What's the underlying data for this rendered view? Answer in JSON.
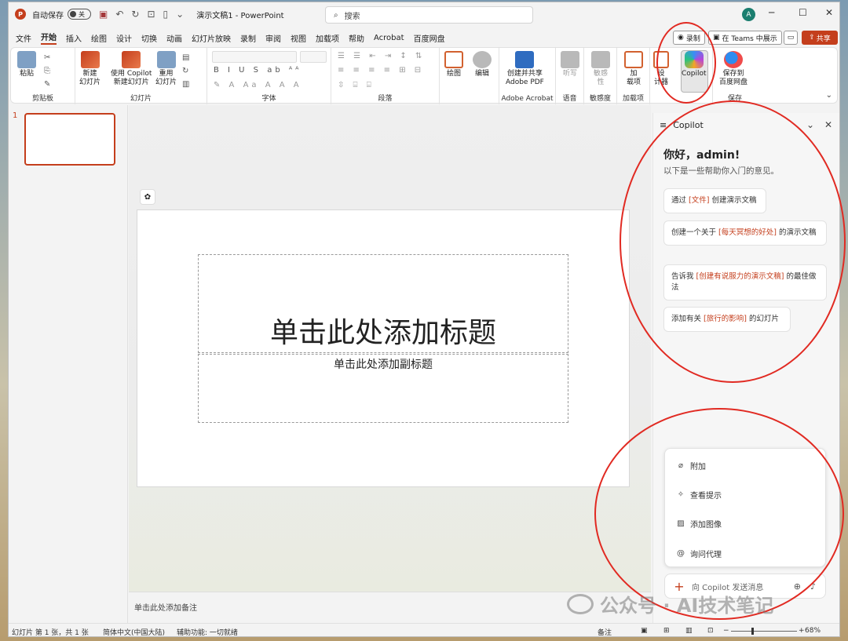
{
  "titlebar": {
    "autosave_label": "自动保存",
    "autosave_state": "关",
    "doc_title": "演示文稿1 - PowerPoint",
    "search_placeholder": "搜索",
    "avatar_initial": "A"
  },
  "menu_tabs": [
    "文件",
    "开始",
    "插入",
    "绘图",
    "设计",
    "切换",
    "动画",
    "幻灯片放映",
    "录制",
    "审阅",
    "视图",
    "加载项",
    "帮助",
    "Acrobat",
    "百度网盘"
  ],
  "active_tab": "开始",
  "title_actions": {
    "record": "录制",
    "teams": "在 Teams 中展示",
    "share": "共享"
  },
  "ribbon": {
    "clipboard": {
      "paste": "粘贴",
      "label": "剪贴板"
    },
    "slides": {
      "new_slide": "新建\n幻灯片",
      "copilot_new": "使用 Copilot\n新建幻灯片",
      "reuse": "重用\n幻灯片",
      "label": "幻灯片"
    },
    "font": {
      "label": "字体"
    },
    "paragraph": {
      "label": "段落"
    },
    "drawing": {
      "draw": "绘图",
      "edit": "编辑"
    },
    "acrobat": {
      "create": "创建并共享\nAdobe PDF",
      "label": "Adobe Acrobat"
    },
    "voice": {
      "dictate": "听写",
      "label": "语音"
    },
    "sensitivity": {
      "btn": "敏感\n性",
      "label": "敏感度"
    },
    "addins": {
      "btn": "加\n载项",
      "label": "加载项"
    },
    "designer": {
      "btn": "设\n计器"
    },
    "copilot": {
      "btn": "Copilot"
    },
    "save": {
      "btn": "保存到\n百度网盘",
      "label": "保存"
    }
  },
  "thumbs": {
    "number": "1"
  },
  "slide": {
    "title_placeholder": "单击此处添加标题",
    "subtitle_placeholder": "单击此处添加副标题"
  },
  "notes_placeholder": "单击此处添加备注",
  "copilot_pane": {
    "title": "Copilot",
    "greeting": "你好，admin!",
    "subtitle": "以下是一些帮助你入门的意见。",
    "suggestions": [
      {
        "pre": "通过 ",
        "hl": "[文件]",
        "post": " 创建演示文稿"
      },
      {
        "pre": "创建一个关于 ",
        "hl": "[每天冥想的好处]",
        "post": " 的演示文稿"
      },
      {
        "pre": "告诉我 ",
        "hl": "[创建有说服力的演示文稿]",
        "post": " 的最佳做法"
      },
      {
        "pre": "添加有关 ",
        "hl": "[旅行的影响]",
        "post": " 的幻灯片"
      }
    ],
    "menu": [
      "附加",
      "查看提示",
      "添加图像",
      "询问代理"
    ],
    "chat_placeholder": "向 Copilot 发送消息"
  },
  "statusbar": {
    "slide_info": "幻灯片 第 1 张，共 1 张",
    "language": "简体中文(中国大陆)",
    "accessibility": "辅助功能: 一切就绪",
    "notes": "备注",
    "zoom": "68%"
  },
  "watermark": "公众号 · AI技术笔记",
  "colors": {
    "accent": "#c43e1c",
    "annotation": "#e12a22"
  }
}
